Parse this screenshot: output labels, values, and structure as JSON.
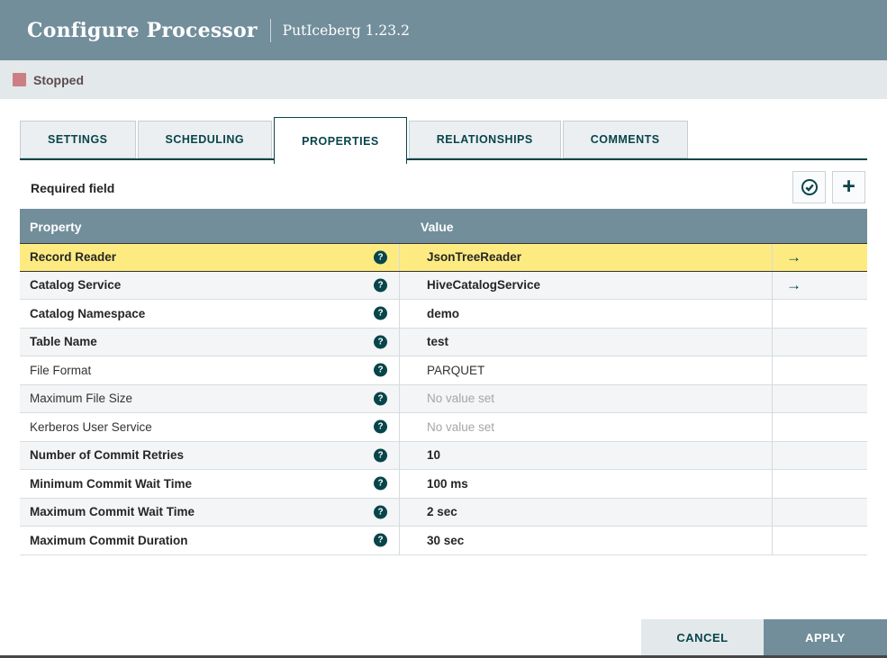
{
  "dialog": {
    "title": "Configure Processor",
    "subtitle": "PutIceberg 1.23.2"
  },
  "status": {
    "label": "Stopped",
    "color": "#cb7f84"
  },
  "tabs": [
    {
      "label": "SETTINGS",
      "active": false
    },
    {
      "label": "SCHEDULING",
      "active": false
    },
    {
      "label": "PROPERTIES",
      "active": true
    },
    {
      "label": "RELATIONSHIPS",
      "active": false
    },
    {
      "label": "COMMENTS",
      "active": false
    }
  ],
  "properties_panel": {
    "required_label": "Required field"
  },
  "icons": {
    "help": "?",
    "plus": "+",
    "go_to_service": "→"
  },
  "table": {
    "columns": [
      "Property",
      "Value"
    ],
    "rows": [
      {
        "property": "Record Reader",
        "value": "JsonTreeReader",
        "required": true,
        "unset": false,
        "highlighted": true,
        "go_to_service": true
      },
      {
        "property": "Catalog Service",
        "value": "HiveCatalogService",
        "required": true,
        "unset": false,
        "highlighted": false,
        "go_to_service": true
      },
      {
        "property": "Catalog Namespace",
        "value": "demo",
        "required": true,
        "unset": false,
        "highlighted": false,
        "go_to_service": false
      },
      {
        "property": "Table Name",
        "value": "test",
        "required": true,
        "unset": false,
        "highlighted": false,
        "go_to_service": false
      },
      {
        "property": "File Format",
        "value": "PARQUET",
        "required": false,
        "unset": false,
        "highlighted": false,
        "go_to_service": false
      },
      {
        "property": "Maximum File Size",
        "value": "No value set",
        "required": false,
        "unset": true,
        "highlighted": false,
        "go_to_service": false
      },
      {
        "property": "Kerberos User Service",
        "value": "No value set",
        "required": false,
        "unset": true,
        "highlighted": false,
        "go_to_service": false
      },
      {
        "property": "Number of Commit Retries",
        "value": "10",
        "required": true,
        "unset": false,
        "highlighted": false,
        "go_to_service": false
      },
      {
        "property": "Minimum Commit Wait Time",
        "value": "100 ms",
        "required": true,
        "unset": false,
        "highlighted": false,
        "go_to_service": false
      },
      {
        "property": "Maximum Commit Wait Time",
        "value": "2 sec",
        "required": true,
        "unset": false,
        "highlighted": false,
        "go_to_service": false
      },
      {
        "property": "Maximum Commit Duration",
        "value": "30 sec",
        "required": true,
        "unset": false,
        "highlighted": false,
        "go_to_service": false
      }
    ]
  },
  "footer": {
    "cancel_label": "CANCEL",
    "apply_label": "APPLY"
  },
  "colors": {
    "header_bg": "#728e9b",
    "status_bg": "#e3e8eb",
    "teal": "#07454a",
    "highlight_row": "#fdeb81",
    "apply_bg": "#728e9b"
  }
}
